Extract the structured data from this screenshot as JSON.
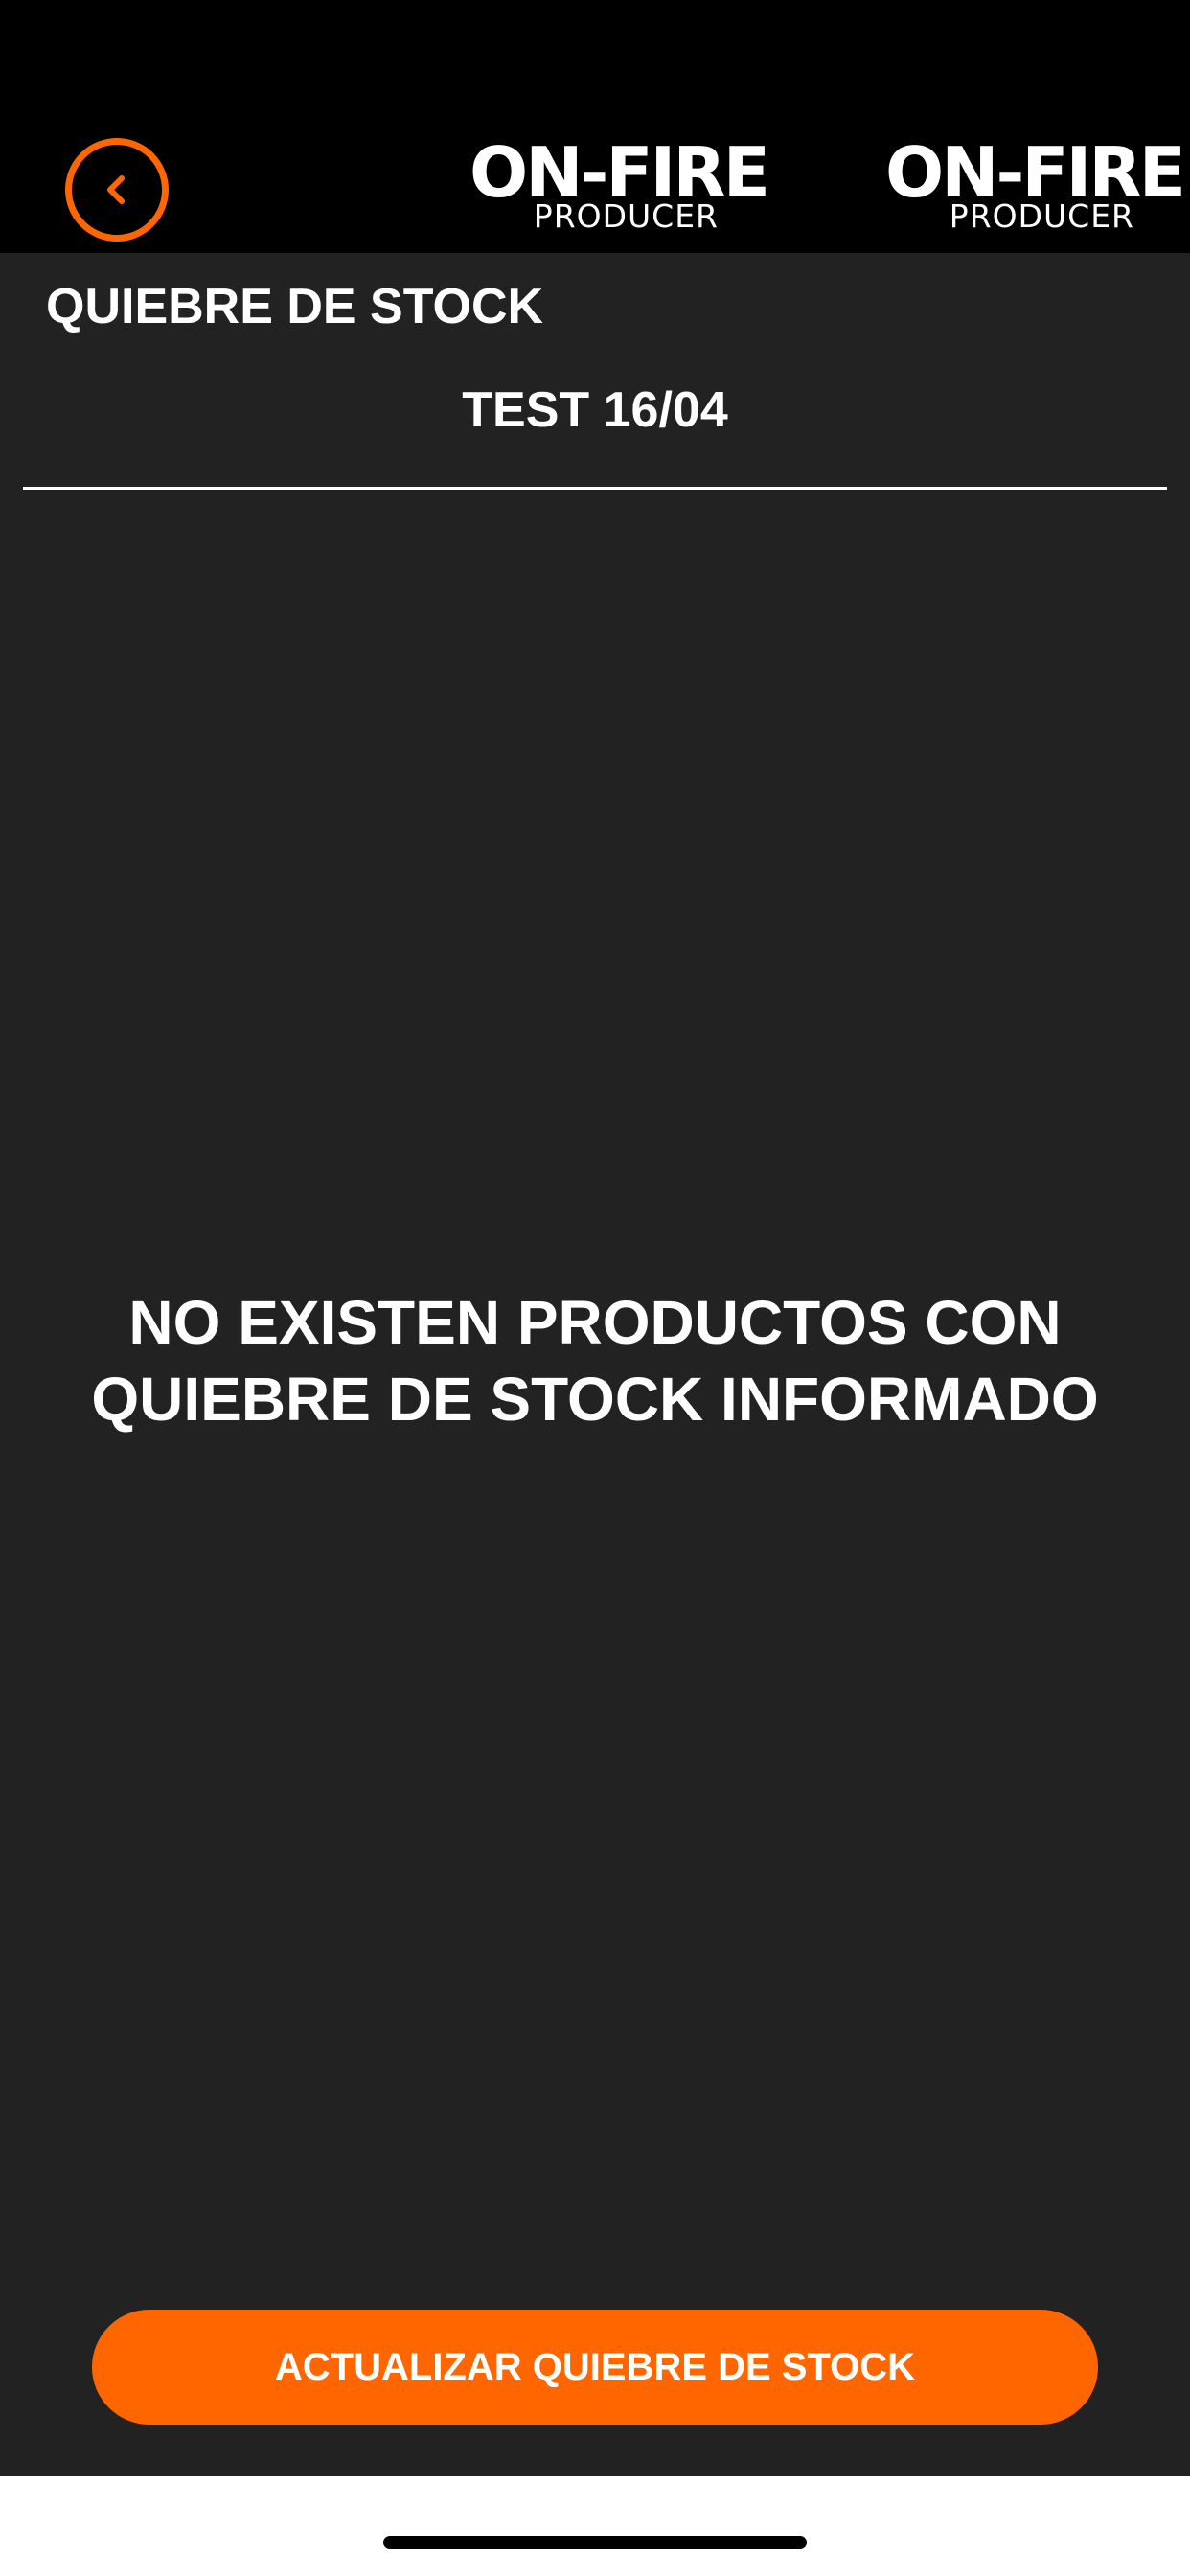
{
  "header": {
    "back_icon": "chevron-left-icon",
    "logo_center": {
      "main": "ON-FIRE",
      "sub": "PRODUCER"
    },
    "logo_right": {
      "main": "ON-FIRE",
      "sub": "PRODUCER"
    }
  },
  "page": {
    "title": "QUIEBRE DE STOCK",
    "event_name": "TEST 16/04"
  },
  "empty_state": {
    "message": "NO EXISTEN PRODUCTOS CON QUIEBRE DE STOCK INFORMADO"
  },
  "actions": {
    "update_label": "ACTUALIZAR QUIEBRE DE STOCK"
  },
  "colors": {
    "accent": "#ff6600",
    "background": "#222222",
    "header_background": "#000000",
    "text": "#ffffff"
  }
}
